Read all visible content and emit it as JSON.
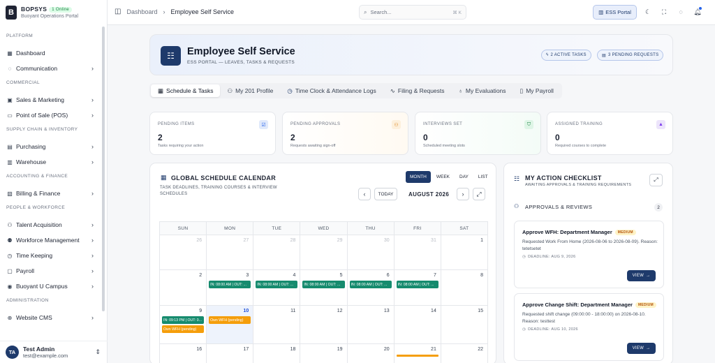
{
  "app": {
    "name": "BOPSYS",
    "online_badge": "1 Online",
    "tagline": "Buoyant Operations Portal"
  },
  "sidebar": {
    "sections": [
      {
        "title": "PLATFORM",
        "items": [
          {
            "label": "Dashboard",
            "icon": "grid-icon"
          },
          {
            "label": "Communication",
            "icon": "chat-icon"
          }
        ]
      },
      {
        "title": "COMMERCIAL",
        "items": [
          {
            "label": "Sales & Marketing",
            "icon": "briefcase-icon"
          },
          {
            "label": "Point of Sale (POS)",
            "icon": "monitor-icon"
          }
        ]
      },
      {
        "title": "SUPPLY CHAIN & INVENTORY",
        "items": [
          {
            "label": "Purchasing",
            "icon": "clipboard-icon"
          },
          {
            "label": "Warehouse",
            "icon": "box-icon"
          }
        ]
      },
      {
        "title": "ACCOUNTING & FINANCE",
        "items": [
          {
            "label": "Billing & Finance",
            "icon": "receipt-icon"
          }
        ]
      },
      {
        "title": "PEOPLE & WORKFORCE",
        "items": [
          {
            "label": "Talent Acquisition",
            "icon": "user-plus-icon"
          },
          {
            "label": "Workforce Management",
            "icon": "users-icon"
          },
          {
            "label": "Time Keeping",
            "icon": "clock-icon"
          },
          {
            "label": "Payroll",
            "icon": "wallet-icon"
          },
          {
            "label": "Buoyant U Campus",
            "icon": "location-icon"
          }
        ]
      },
      {
        "title": "ADMINISTRATION",
        "items": [
          {
            "label": "Website CMS",
            "icon": "globe-icon"
          }
        ]
      }
    ]
  },
  "user": {
    "initials": "TA",
    "name": "Test Admin",
    "email": "test@example.com"
  },
  "topbar": {
    "breadcrumb_root": "Dashboard",
    "breadcrumb_current": "Employee Self Service",
    "search_placeholder": "Search...",
    "search_shortcut": "⌘ K",
    "ess_button": "ESS Portal"
  },
  "hero": {
    "title": "Employee Self Service",
    "subtitle": "ESS PORTAL — LEAVES, TASKS & REQUESTS",
    "badge_tasks": "2 ACTIVE TASKS",
    "badge_requests": "3 PENDING REQUESTS"
  },
  "tabs": [
    {
      "label": "Schedule & Tasks",
      "icon": "calendar-icon"
    },
    {
      "label": "My 201 Profile",
      "icon": "user-icon"
    },
    {
      "label": "Time Clock & Attendance Logs",
      "icon": "clock-icon"
    },
    {
      "label": "Filing & Requests",
      "icon": "activity-icon"
    },
    {
      "label": "My Evaluations",
      "icon": "award-icon"
    },
    {
      "label": "My Payroll",
      "icon": "file-icon"
    }
  ],
  "stats": [
    {
      "title": "PENDING ITEMS",
      "value": "2",
      "desc": "Tasks requiring your action",
      "icon": "check-square-icon",
      "color": "#2563eb",
      "bg": "#e0e9fb"
    },
    {
      "title": "PENDING APPROVALS",
      "value": "2",
      "desc": "Requests awaiting sign-off",
      "icon": "user-check-icon",
      "color": "#d97706",
      "bg": "#fdf0dc"
    },
    {
      "title": "INTERVIEWS SET",
      "value": "0",
      "desc": "Scheduled meeting slots",
      "icon": "shield-icon",
      "color": "#15803d",
      "bg": "#def5e6"
    },
    {
      "title": "ASSIGNED TRAINING",
      "value": "0",
      "desc": "Required courses to complete",
      "icon": "graduation-cap-icon",
      "color": "#7c3aed",
      "bg": "#ece4fb"
    }
  ],
  "calendar": {
    "title": "GLOBAL SCHEDULE CALENDAR",
    "subtitle": "TASK DEADLINES, TRAINING COURSES & INTERVIEW SCHEDULES",
    "views": [
      "MONTH",
      "WEEK",
      "DAY",
      "LIST"
    ],
    "today_label": "TODAY",
    "month_label": "AUGUST 2026",
    "weekdays": [
      "SUN",
      "MON",
      "TUE",
      "WED",
      "THU",
      "FRI",
      "SAT"
    ],
    "week1": [
      "26",
      "27",
      "28",
      "29",
      "30",
      "31",
      "1"
    ],
    "week2": [
      "2",
      "3",
      "4",
      "5",
      "6",
      "7",
      "8"
    ],
    "week3": [
      "9",
      "10",
      "11",
      "12",
      "13",
      "14",
      "15"
    ],
    "week4": [
      "16",
      "17",
      "18",
      "19",
      "20",
      "21",
      "22"
    ],
    "ev_clock": "IN: 08:00 AM | OUT: ...",
    "ev_clock_9": "IN: 09:13 PM | OUT: 0...",
    "ev_wfh": "Own WFH (pending)"
  },
  "checklist": {
    "title": "MY ACTION CHECKLIST",
    "subtitle": "AWAITING APPROVALS & TRAINING REQUIREMENTS",
    "section": "APPROVALS & REVIEWS",
    "count": "2",
    "cards": [
      {
        "title": "Approve WFH: Department Manager",
        "priority": "MEDIUM",
        "desc": "Requested Work From Home (2026-08-06 to 2026-08-09). Reason: tetetsetet",
        "deadline": "DEADLINE: AUG 9, 2026",
        "button": "VIEW"
      },
      {
        "title": "Approve Change Shift: Department Manager",
        "priority": "MEDIUM",
        "desc": "Requested shift change (09:00:00 - 18:00:00) on 2026-08-10. Reason: testtest",
        "deadline": "DEADLINE: AUG 10, 2026",
        "button": "VIEW"
      }
    ]
  }
}
